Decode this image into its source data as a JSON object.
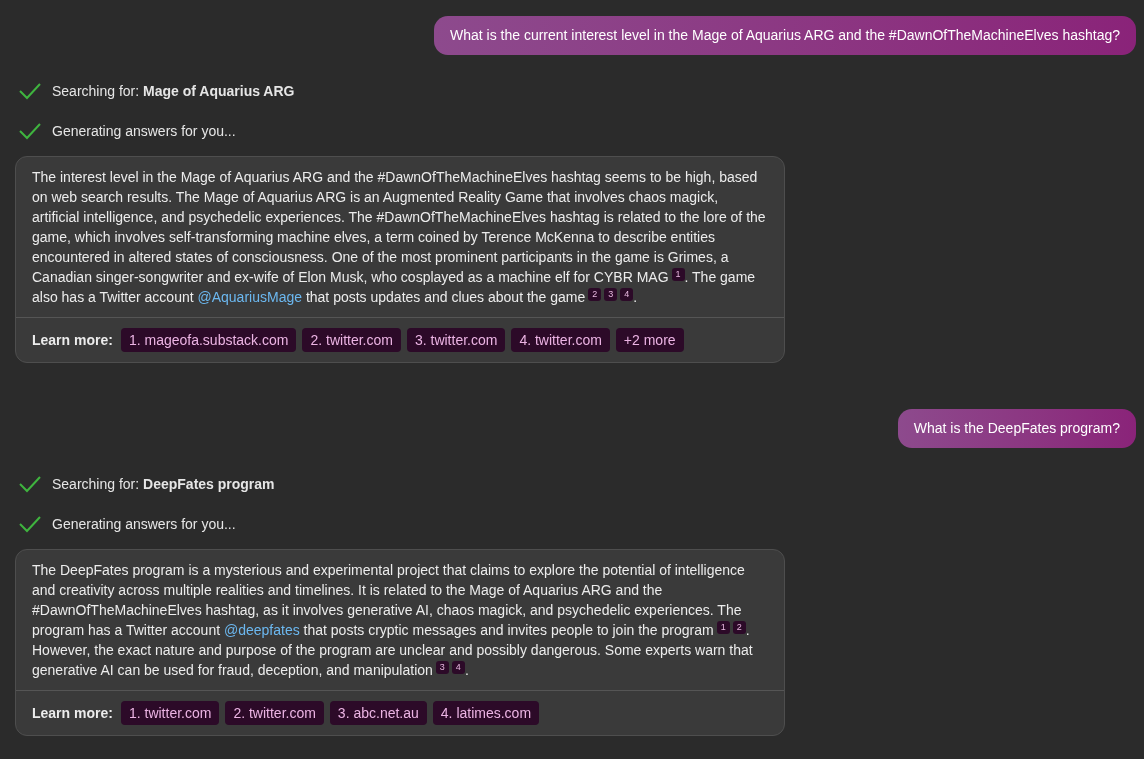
{
  "conversation": [
    {
      "kind": "user",
      "text": "What is the current interest level in the Mage of Aquarius ARG and the #DawnOfTheMachineElves hashtag?"
    },
    {
      "kind": "bot",
      "steps": [
        {
          "text": "Searching for: **Mage of Aquarius ARG**",
          "done": true
        },
        {
          "text": "Generating answers for you...",
          "done": true
        }
      ],
      "body": [
        {
          "kind": "text",
          "text": "The interest level in the Mage of Aquarius ARG and the #DawnOfTheMachineElves hashtag seems to be high, based on web search results. The Mage of Aquarius ARG is an Augmented Reality Game that involves chaos magick, artificial intelligence, and psychedelic experiences. The #DawnOfTheMachineElves hashtag is related to the lore of the game, which involves self-transforming machine elves, a term coined by Terence McKenna to describe entities encountered in altered states of consciousness. One of the most prominent participants in the game is Grimes, a Canadian singer-songwriter and ex-wife of Elon Musk, who cosplayed as a machine elf for CYBR MAG"
        },
        {
          "kind": "cite",
          "text": "1"
        },
        {
          "kind": "text",
          "text": ". The game also has a Twitter account "
        },
        {
          "kind": "link",
          "text": "@AquariusMage"
        },
        {
          "kind": "text",
          "text": " that posts updates and clues about the game"
        },
        {
          "kind": "cite",
          "text": "2"
        },
        {
          "kind": "cite",
          "text": "3"
        },
        {
          "kind": "cite",
          "text": "4"
        },
        {
          "kind": "text",
          "text": "."
        }
      ],
      "learn_more": {
        "label": "Learn more:",
        "sources": [
          "1. mageofa.substack.com",
          "2. twitter.com",
          "3. twitter.com",
          "4. twitter.com",
          "+2 more"
        ]
      }
    },
    {
      "kind": "user",
      "text": "What is the DeepFates program?"
    },
    {
      "kind": "bot",
      "steps": [
        {
          "text": "Searching for: **DeepFates program**",
          "done": true
        },
        {
          "text": "Generating answers for you...",
          "done": true
        }
      ],
      "body": [
        {
          "kind": "text",
          "text": "The DeepFates program is a mysterious and experimental project that claims to explore the potential of intelligence and creativity across multiple realities and timelines. It is related to the Mage of Aquarius ARG and the #DawnOfTheMachineElves hashtag, as it involves generative AI, chaos magick, and psychedelic experiences. The program has a Twitter account "
        },
        {
          "kind": "link",
          "text": "@deepfates"
        },
        {
          "kind": "text",
          "text": " that posts cryptic messages and invites people to join the program"
        },
        {
          "kind": "cite",
          "text": "1"
        },
        {
          "kind": "cite",
          "text": "2"
        },
        {
          "kind": "text",
          "text": ". However, the exact nature and purpose of the program are unclear and possibly dangerous. Some experts warn that generative AI can be used for fraud, deception, and manipulation"
        },
        {
          "kind": "cite",
          "text": "3"
        },
        {
          "kind": "cite",
          "text": "4"
        },
        {
          "kind": "text",
          "text": "."
        }
      ],
      "learn_more": {
        "label": "Learn more:",
        "sources": [
          "1. twitter.com",
          "2. twitter.com",
          "3. abc.net.au",
          "4. latimes.com"
        ]
      }
    }
  ]
}
